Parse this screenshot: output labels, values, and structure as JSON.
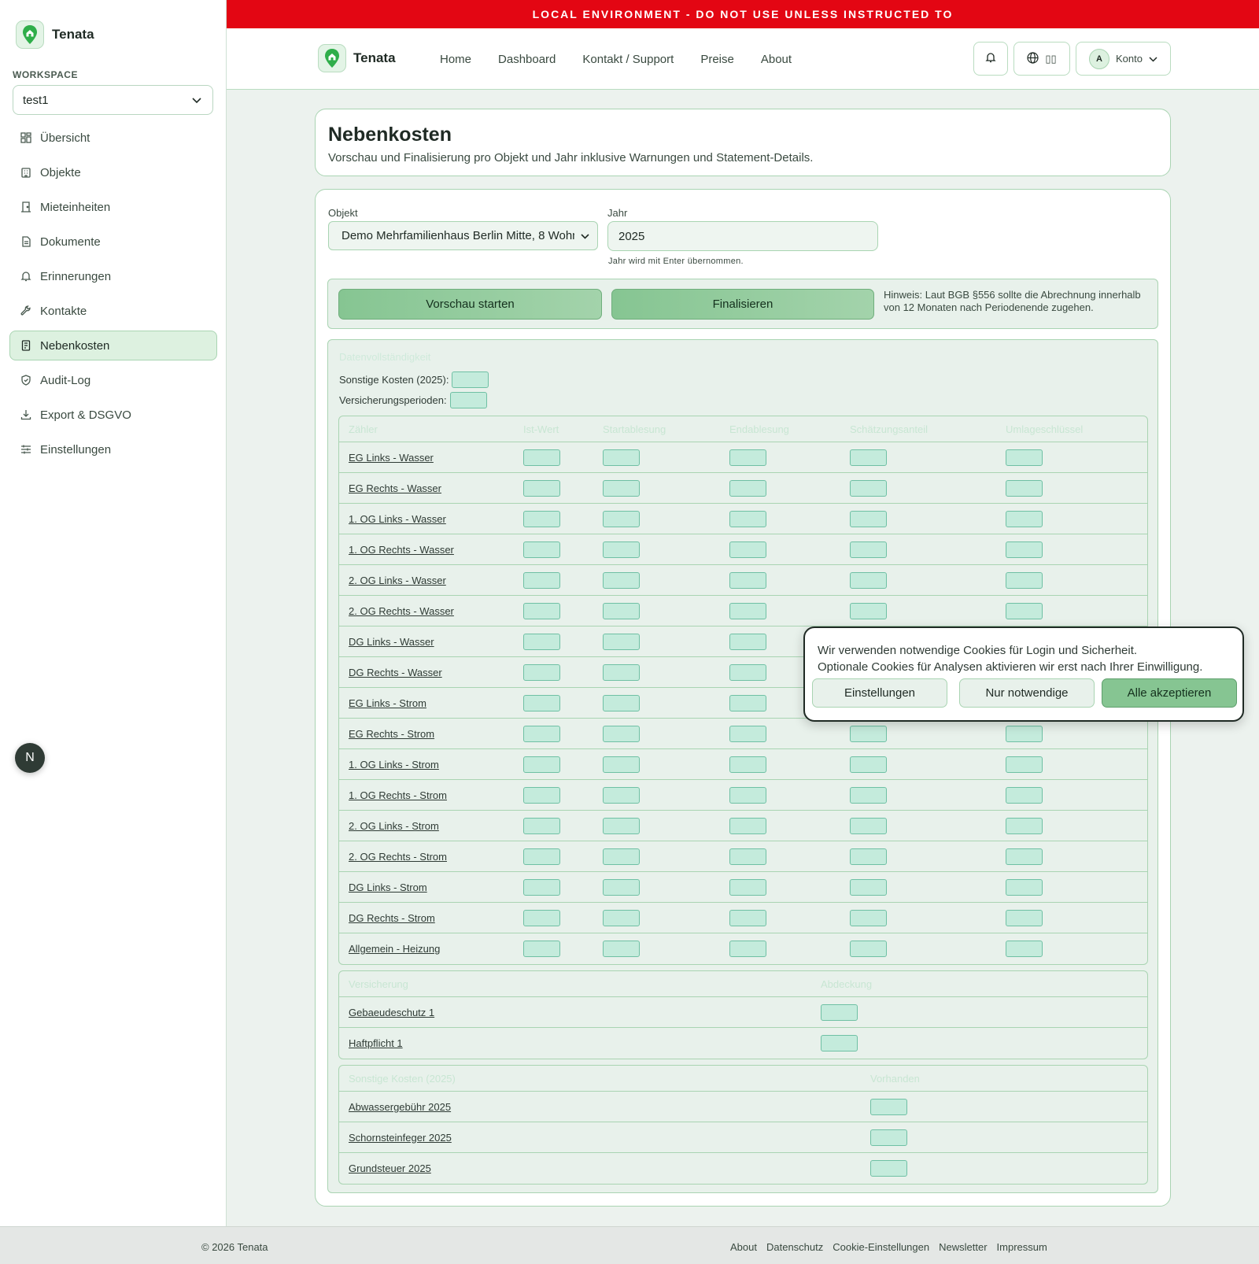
{
  "sidebar": {
    "brand": "Tenata",
    "workspace_label": "WORKSPACE",
    "workspace_value": "test1",
    "items": [
      {
        "label": "Übersicht",
        "icon": "grid-icon"
      },
      {
        "label": "Objekte",
        "icon": "building-icon"
      },
      {
        "label": "Mieteinheiten",
        "icon": "door-icon"
      },
      {
        "label": "Dokumente",
        "icon": "document-icon"
      },
      {
        "label": "Erinnerungen",
        "icon": "bell-icon"
      },
      {
        "label": "Kontakte",
        "icon": "wrench-icon"
      },
      {
        "label": "Nebenkosten",
        "icon": "receipt-icon",
        "active": true
      },
      {
        "label": "Audit-Log",
        "icon": "shield-icon"
      },
      {
        "label": "Export & DSGVO",
        "icon": "download-icon"
      },
      {
        "label": "Einstellungen",
        "icon": "sliders-icon"
      }
    ],
    "bottom_badge": "N"
  },
  "banner": "LOCAL ENVIRONMENT - DO NOT USE UNLESS INSTRUCTED TO",
  "header": {
    "brand": "Tenata",
    "links": [
      "Home",
      "Dashboard",
      "Kontakt / Support",
      "Preise",
      "About"
    ],
    "lang_label": "▯▯",
    "avatar": "A",
    "account": "Konto"
  },
  "page": {
    "title": "Nebenkosten",
    "subtitle": "Vorschau und Finalisierung pro Objekt und Jahr inklusive Warnungen und Statement-Details."
  },
  "form": {
    "object_label": "Objekt",
    "object_value": "Demo Mehrfamilienhaus Berlin Mitte, 8 Wohnu",
    "year_label": "Jahr",
    "year_value": "2025",
    "year_help": "Jahr wird mit Enter übernommen."
  },
  "actions": {
    "preview": "Vorschau starten",
    "finalize": "Finalisieren",
    "note": "Hinweis: Laut BGB §556 sollte die Abrechnung innerhalb von 12 Monaten nach Periodenende zugehen."
  },
  "results": {
    "heading": "Datenvollständigkeit",
    "other_costs_label": "Sonstige Kosten (2025):",
    "insurance_label": "Versicherungsperioden:",
    "meters": {
      "columns": [
        "Zähler",
        "Ist-Wert",
        "Startablesung",
        "Endablesung",
        "Schätzungsanteil",
        "Umlageschlüssel"
      ],
      "rows": [
        "EG Links - Wasser",
        "EG Rechts - Wasser",
        "1. OG Links - Wasser",
        "1. OG Rechts - Wasser",
        "2. OG Links - Wasser",
        "2. OG Rechts - Wasser",
        "DG Links - Wasser",
        "DG Rechts - Wasser",
        "EG Links - Strom",
        "EG Rechts - Strom",
        "1. OG Links - Strom",
        "1. OG Rechts - Strom",
        "2. OG Links - Strom",
        "2. OG Rechts - Strom",
        "DG Links - Strom",
        "DG Rechts - Strom",
        "Allgemein - Heizung"
      ]
    },
    "insurance": {
      "columns": [
        "Versicherung",
        "Abdeckung"
      ],
      "rows": [
        "Gebaeudeschutz 1",
        "Haftpflicht 1"
      ]
    },
    "other_costs": {
      "columns": [
        "Sonstige Kosten (2025)",
        "Vorhanden"
      ],
      "rows": [
        "Abwassergebühr 2025",
        "Schornsteinfeger 2025",
        "Grundsteuer 2025"
      ]
    }
  },
  "cookie": {
    "line1": "Wir verwenden notwendige Cookies für Login und Sicherheit.",
    "line2": "Optionale Cookies für Analysen aktivieren wir erst nach Ihrer Einwilligung.",
    "settings": "Einstellungen",
    "necessary": "Nur notwendige",
    "accept": "Alle akzeptieren"
  },
  "footer": {
    "copyright": "© 2026 Tenata",
    "links": [
      "About",
      "Datenschutz",
      "Cookie-Einstellungen",
      "Newsletter",
      "Impressum"
    ]
  }
}
